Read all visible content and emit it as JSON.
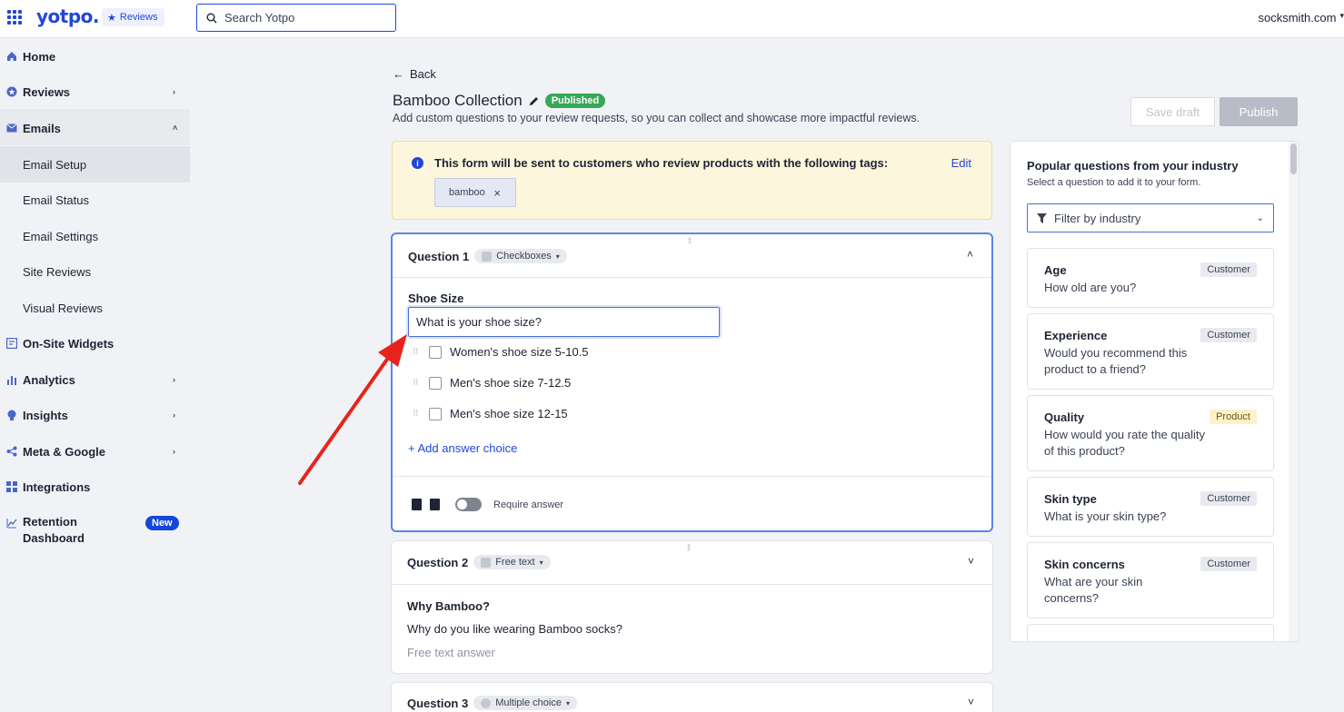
{
  "header": {
    "brand": "yotpo.",
    "product": "Reviews",
    "search_placeholder": "Search Yotpo",
    "account": "socksmith.com"
  },
  "sidebar": {
    "items": [
      {
        "label": "Home",
        "icon": "home-icon"
      },
      {
        "label": "Reviews",
        "icon": "star-icon"
      },
      {
        "label": "Emails",
        "icon": "mail-icon"
      },
      {
        "label": "On-Site Widgets",
        "icon": "widget-icon"
      },
      {
        "label": "Analytics",
        "icon": "bar-chart-icon"
      },
      {
        "label": "Insights",
        "icon": "lightbulb-icon"
      },
      {
        "label": "Meta & Google",
        "icon": "share-icon"
      },
      {
        "label": "Integrations",
        "icon": "grid-icon"
      },
      {
        "label": "Retention",
        "label2": "Dashboard",
        "icon": "trend-icon",
        "badge": "New"
      }
    ],
    "email_sub": [
      "Email Setup",
      "Email Status",
      "Email Settings",
      "Site Reviews",
      "Visual Reviews"
    ]
  },
  "main": {
    "back": "Back",
    "title": "Bamboo Collection",
    "status": "Published",
    "subtitle": "Add custom questions to your review requests, so you can collect and showcase more impactful reviews.",
    "save_draft": "Save draft",
    "publish": "Publish",
    "notice": {
      "message": "This form will be sent to customers who review products with the following tags:",
      "edit": "Edit",
      "tag": "bamboo"
    },
    "q1": {
      "heading": "Question 1",
      "type": "Checkboxes",
      "label": "Shoe Size",
      "question": "What is your shoe size?",
      "choices": [
        "Women's shoe size 5-10.5",
        "Men's shoe size 7-12.5",
        "Men's shoe size 12-15"
      ],
      "add_choice": "+ Add answer choice",
      "require": "Require answer"
    },
    "q2": {
      "heading": "Question 2",
      "type": "Free text",
      "title": "Why Bamboo?",
      "question": "Why do you like wearing Bamboo socks?",
      "placeholder": "Free text answer"
    },
    "q3": {
      "heading": "Question 3",
      "type": "Multiple choice"
    }
  },
  "panel": {
    "title": "Popular questions from your industry",
    "subtitle": "Select a question to add it to your form.",
    "filter_placeholder": "Filter by industry",
    "suggestions": [
      {
        "title": "Age",
        "desc": "How old are you?",
        "badge": "Customer"
      },
      {
        "title": "Experience",
        "desc": "Would you recommend this product to a friend?",
        "badge": "Customer"
      },
      {
        "title": "Quality",
        "desc": "How would you rate the quality of this product?",
        "badge": "Product"
      },
      {
        "title": "Skin type",
        "desc": "What is your skin type?",
        "badge": "Customer"
      },
      {
        "title": "Skin concerns",
        "desc": "What are your skin concerns?",
        "badge": "Customer"
      }
    ]
  },
  "colors": {
    "accent": "#2147d9",
    "published": "#35a957",
    "arrow": "#e8231c"
  }
}
